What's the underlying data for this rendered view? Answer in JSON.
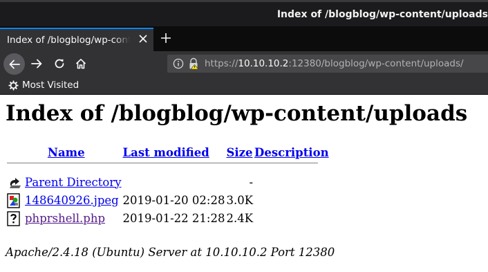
{
  "window": {
    "title": "Index of /blogblog/wp-content/uploads"
  },
  "tab": {
    "title": "Index of /blogblog/wp-content/uploads",
    "close_icon": "close-icon",
    "new_tab_icon": "plus-icon"
  },
  "nav": {
    "back_icon": "arrow-left-icon",
    "forward_icon": "arrow-right-icon",
    "reload_icon": "reload-icon",
    "home_icon": "home-icon"
  },
  "url": {
    "scheme": "https://",
    "host": "10.10.10.2",
    "rest": ":12380/blogblog/wp-content/uploads/"
  },
  "bookmarks": {
    "items": [
      {
        "label": "Most Visited",
        "icon": "gear-icon"
      }
    ]
  },
  "page": {
    "heading": "Index of /blogblog/wp-content/uploads",
    "columns": {
      "name": "Name",
      "last_modified": "Last modified",
      "size": "Size",
      "description": "Description"
    },
    "rows": [
      {
        "icon": "parent-directory-icon",
        "name": "Parent Directory",
        "modified": "",
        "size": "-",
        "description": ""
      },
      {
        "icon": "image-file-icon",
        "name": "148640926.jpeg",
        "modified": "2019-01-20 02:28",
        "size": "3.0K",
        "description": ""
      },
      {
        "icon": "unknown-file-icon",
        "name": "phprshell.php",
        "modified": "2019-01-22 21:28",
        "size": "2.4K",
        "description": ""
      }
    ],
    "address": "Apache/2.4.18 (Ubuntu) Server at 10.10.10.2 Port 12380"
  },
  "colors": {
    "link": "#0000ee",
    "visited_link": "#551a8b",
    "toolbar": "#323234",
    "titlebar": "#1b1b1d",
    "tab_accent": "#0a84ff"
  }
}
